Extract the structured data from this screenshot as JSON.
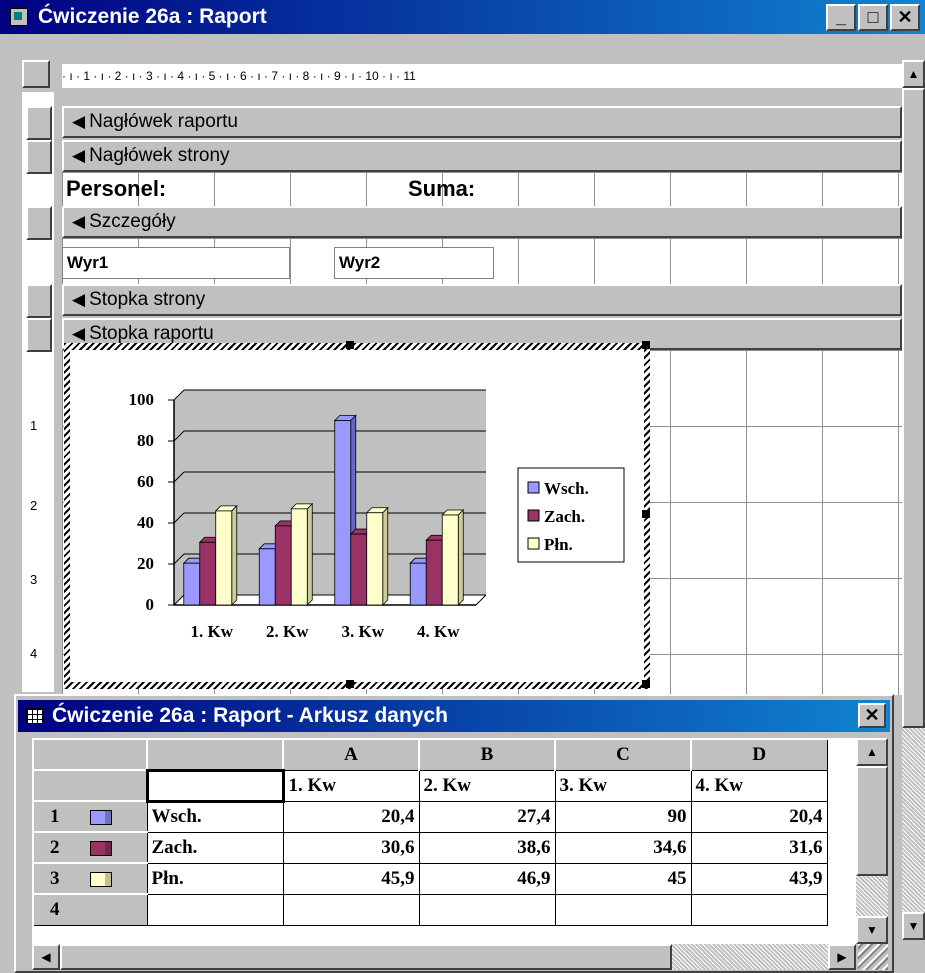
{
  "window": {
    "title": "Ćwiczenie 26a : Raport",
    "min_glyph": "_",
    "max_glyph": "□",
    "close_glyph": "✕"
  },
  "ruler": {
    "text": "·  ı  ·  1  ·  ı  ·  2  ·  ı  ·  3  ·  ı  ·  4  ·  ı  ·  5  ·  ı  ·  6  ·  ı  ·  7  ·  ı  ·  8  ·  ı  ·  9  ·  ı  ·  10  ·  ı  ·  11"
  },
  "sections": {
    "report_header": "Nagłówek raportu",
    "page_header": "Nagłówek strony",
    "details": "Szczegóły",
    "page_footer": "Stopka strony",
    "report_footer": "Stopka raportu",
    "arrow_glyph": "◀"
  },
  "page_header_labels": {
    "personel": "Personel:",
    "suma": "Suma:"
  },
  "detail_fields": {
    "expr1": "Wyr1",
    "expr2": "Wyr2"
  },
  "chart_data": {
    "type": "bar",
    "categories": [
      "1. Kw",
      "2. Kw",
      "3. Kw",
      "4. Kw"
    ],
    "series": [
      {
        "name": "Wsch.",
        "values": [
          20.4,
          27.4,
          90,
          20.4
        ],
        "color": "#9999ff"
      },
      {
        "name": "Zach.",
        "values": [
          30.6,
          38.6,
          34.6,
          31.6
        ],
        "color": "#993366"
      },
      {
        "name": "Płn.",
        "values": [
          45.9,
          46.9,
          45,
          43.9
        ],
        "color": "#ffffcc"
      }
    ],
    "yticks": [
      "100",
      "80",
      "60",
      "40",
      "20",
      "0"
    ],
    "ylim": [
      0,
      100
    ],
    "legend": "right",
    "grid": true
  },
  "datasheet": {
    "title": "Ćwiczenie 26a : Raport - Arkusz danych",
    "close_glyph": "✕",
    "col_headers": [
      "A",
      "B",
      "C",
      "D"
    ],
    "header_row": [
      "",
      "1. Kw",
      "2. Kw",
      "3. Kw",
      "4. Kw"
    ],
    "rows": [
      {
        "num": "1",
        "label": "Wsch.",
        "values": [
          "20,4",
          "27,4",
          "90",
          "20,4"
        ],
        "color": "#9999ff"
      },
      {
        "num": "2",
        "label": "Zach.",
        "values": [
          "30,6",
          "38,6",
          "34,6",
          "31,6"
        ],
        "color": "#993366"
      },
      {
        "num": "3",
        "label": "Płn.",
        "values": [
          "45,9",
          "46,9",
          "45",
          "43,9"
        ],
        "color": "#ffffcc"
      },
      {
        "num": "4",
        "label": "",
        "values": [
          "",
          "",
          "",
          ""
        ],
        "color": ""
      }
    ]
  },
  "vruler_digits": [
    "1",
    "2",
    "3",
    "4"
  ]
}
